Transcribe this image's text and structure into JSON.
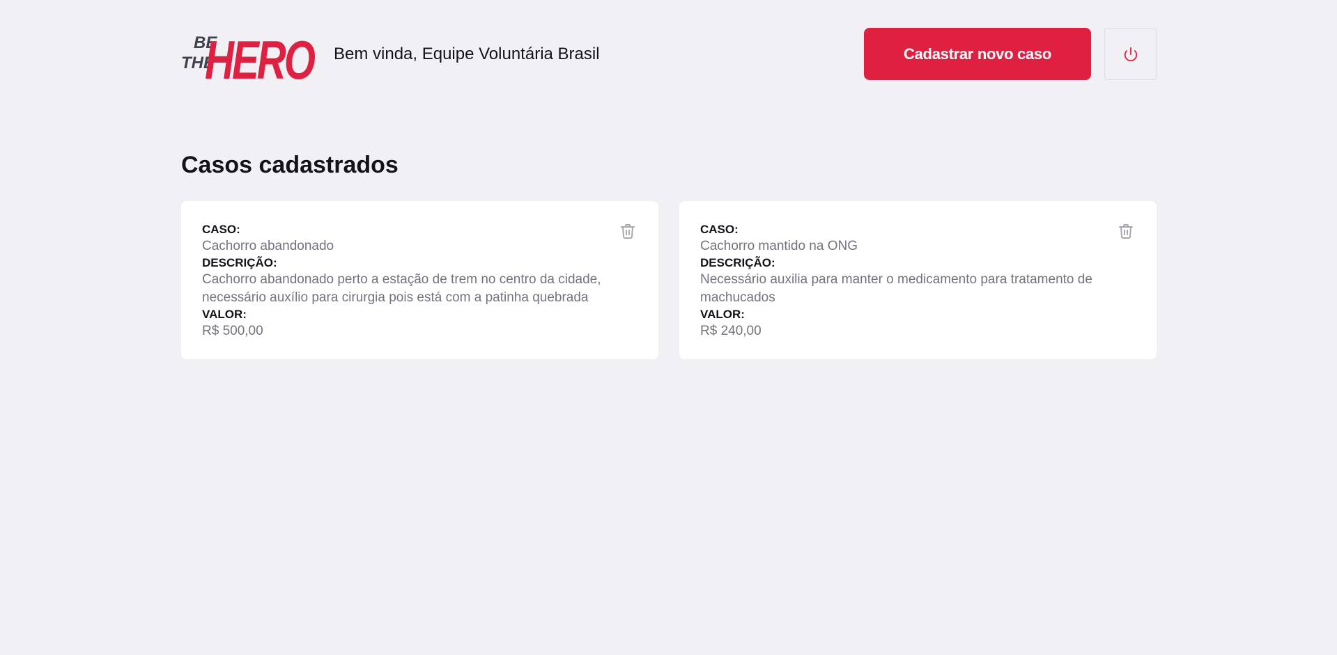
{
  "header": {
    "logo_line1": "BE",
    "logo_line2": "THE",
    "logo_hero": "HERO",
    "welcome": "Bem vinda, Equipe Voluntária Brasil",
    "new_case_label": "Cadastrar novo caso",
    "logout_icon": "power-icon"
  },
  "main": {
    "title": "Casos cadastrados",
    "labels": {
      "case": "CASO:",
      "description": "DESCRIÇÃO:",
      "value": "VALOR:"
    },
    "cases": [
      {
        "title": "Cachorro abandonado",
        "description": "Cachorro abandonado perto a estação de trem no centro da cidade, necessário auxílio para cirurgia pois está com a patinha quebrada",
        "value": "R$ 500,00",
        "delete_icon": "trash-icon"
      },
      {
        "title": "Cachorro mantido na ONG",
        "description": "Necessário auxilia para manter o medicamento para tratamento de machucados",
        "value": "R$ 240,00",
        "delete_icon": "trash-icon"
      }
    ]
  },
  "colors": {
    "accent": "#e02041",
    "background": "#f0f0f5",
    "card": "#ffffff",
    "text": "#13131a",
    "muted": "#737380",
    "logo_dark": "#41414d"
  }
}
